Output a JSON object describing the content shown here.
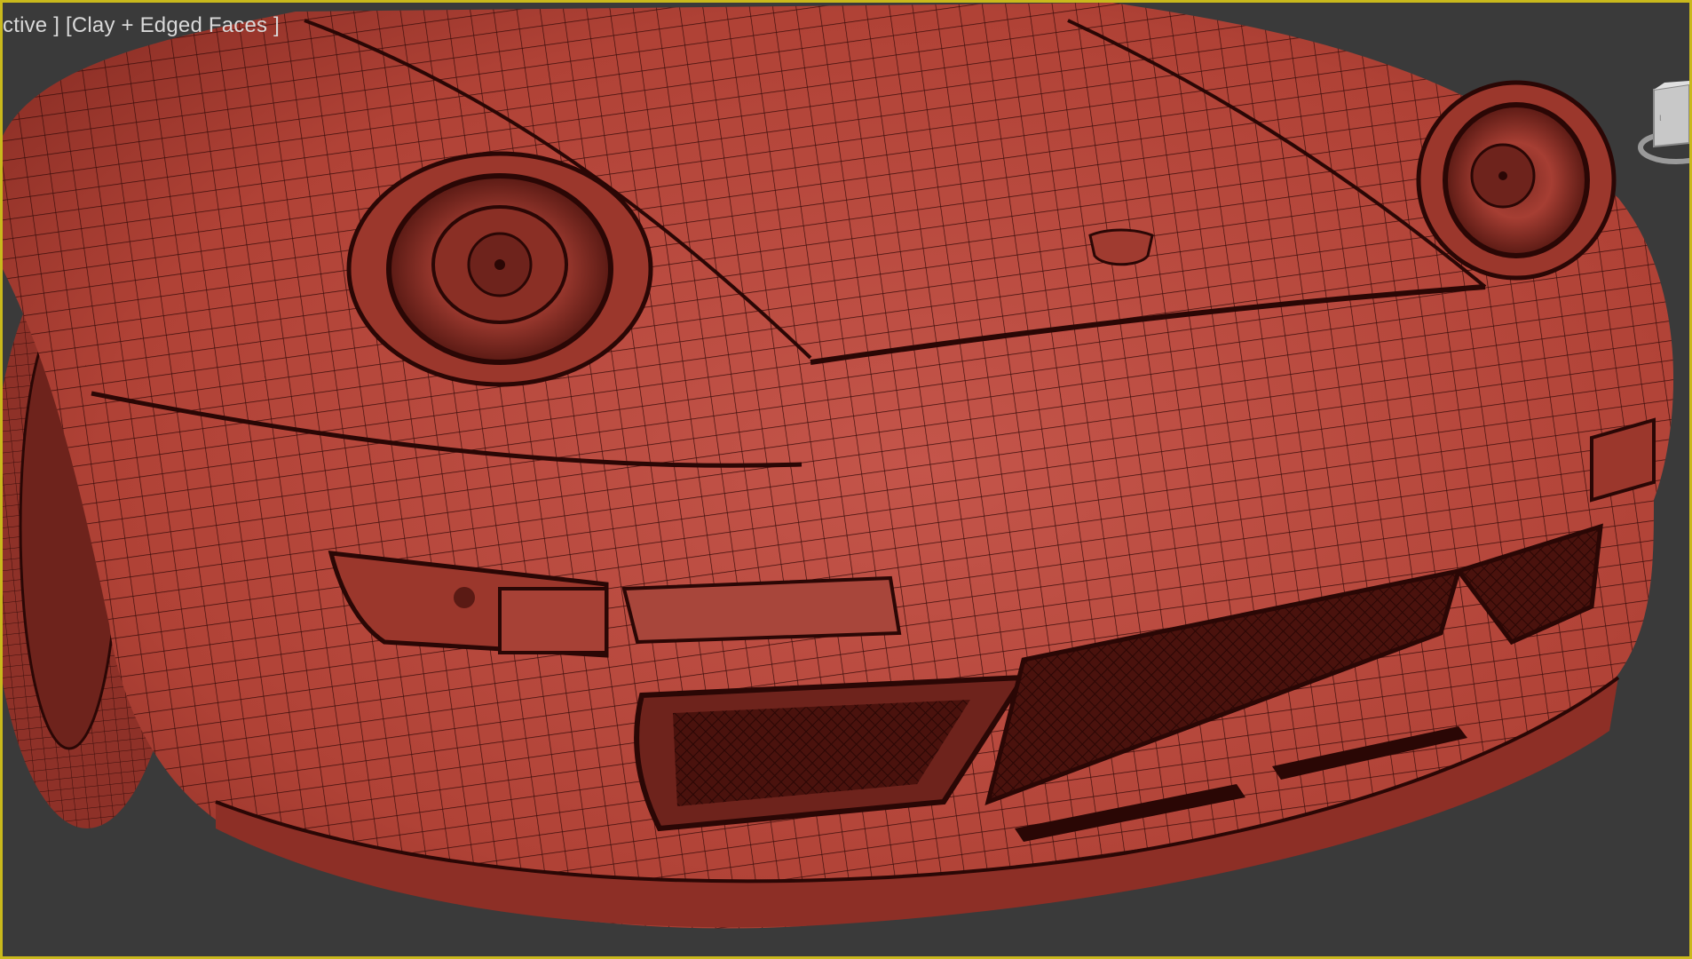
{
  "viewport": {
    "label_view": "ctive ]",
    "label_shading": "[Clay + Edged Faces ]"
  },
  "colors": {
    "background": "#3a3a3a",
    "active_border": "#c9b91c",
    "clay": "#b9483c",
    "wire": "#3b0e0b"
  },
  "icons": {
    "viewcube": "viewcube-icon"
  }
}
